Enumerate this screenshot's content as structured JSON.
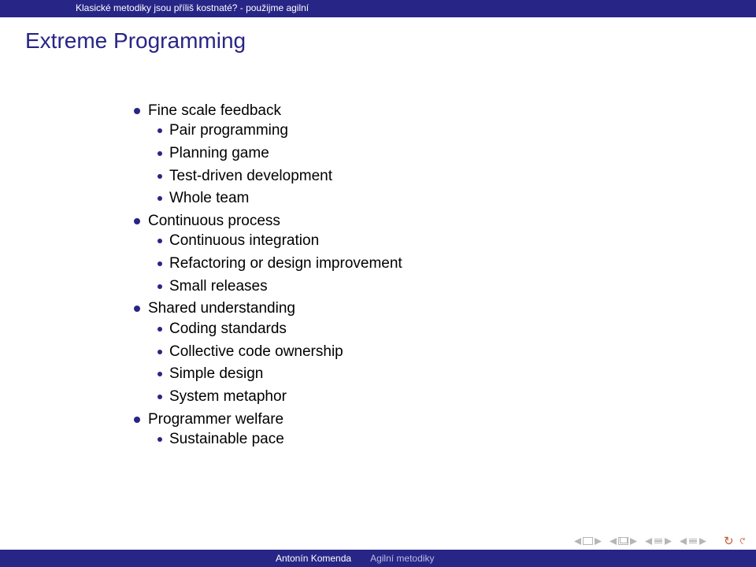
{
  "header": {
    "text": "Klasické metodiky jsou příliš kostnaté? - použijme agilní"
  },
  "title": "Extreme Programming",
  "list": [
    {
      "label": "Fine scale feedback",
      "children": [
        "Pair programming",
        "Planning game",
        "Test-driven development",
        "Whole team"
      ]
    },
    {
      "label": "Continuous process",
      "children": [
        "Continuous integration",
        "Refactoring or design improvement",
        "Small releases"
      ]
    },
    {
      "label": "Shared understanding",
      "children": [
        "Coding standards",
        "Collective code ownership",
        "Simple design",
        "System metaphor"
      ]
    },
    {
      "label": "Programmer welfare",
      "children": [
        "Sustainable pace"
      ]
    }
  ],
  "footer": {
    "author": "Antonín Komenda",
    "topic": "Agilní metodiky"
  }
}
